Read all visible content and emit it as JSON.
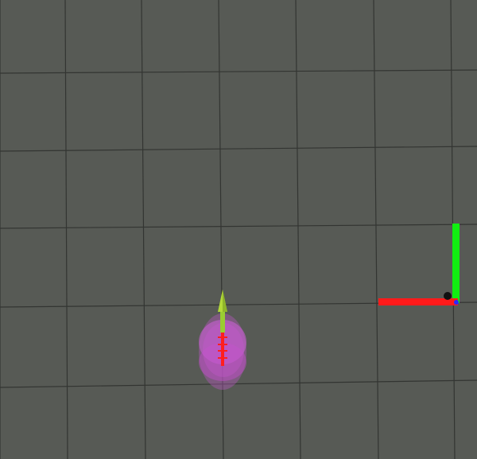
{
  "scene": {
    "type": "3d-visualization-viewport",
    "colors": {
      "background": "#575a55",
      "grid": "#333532",
      "particle_cloud": "#c85ad2",
      "particle_arrow": "#ff1e1e",
      "pose_arrow": "#9acd32",
      "axis_x": "#ff1a1a",
      "axis_y": "#11ee11",
      "axis_z": "#2a2aff",
      "robot_marker": "#111111"
    },
    "objects": [
      {
        "name": "map-grid",
        "icon": "grid"
      },
      {
        "name": "particle-cloud",
        "icon": "pose-array"
      },
      {
        "name": "estimated-pose-arrow",
        "icon": "arrow"
      },
      {
        "name": "base-frame-axes",
        "icon": "axes"
      }
    ]
  }
}
